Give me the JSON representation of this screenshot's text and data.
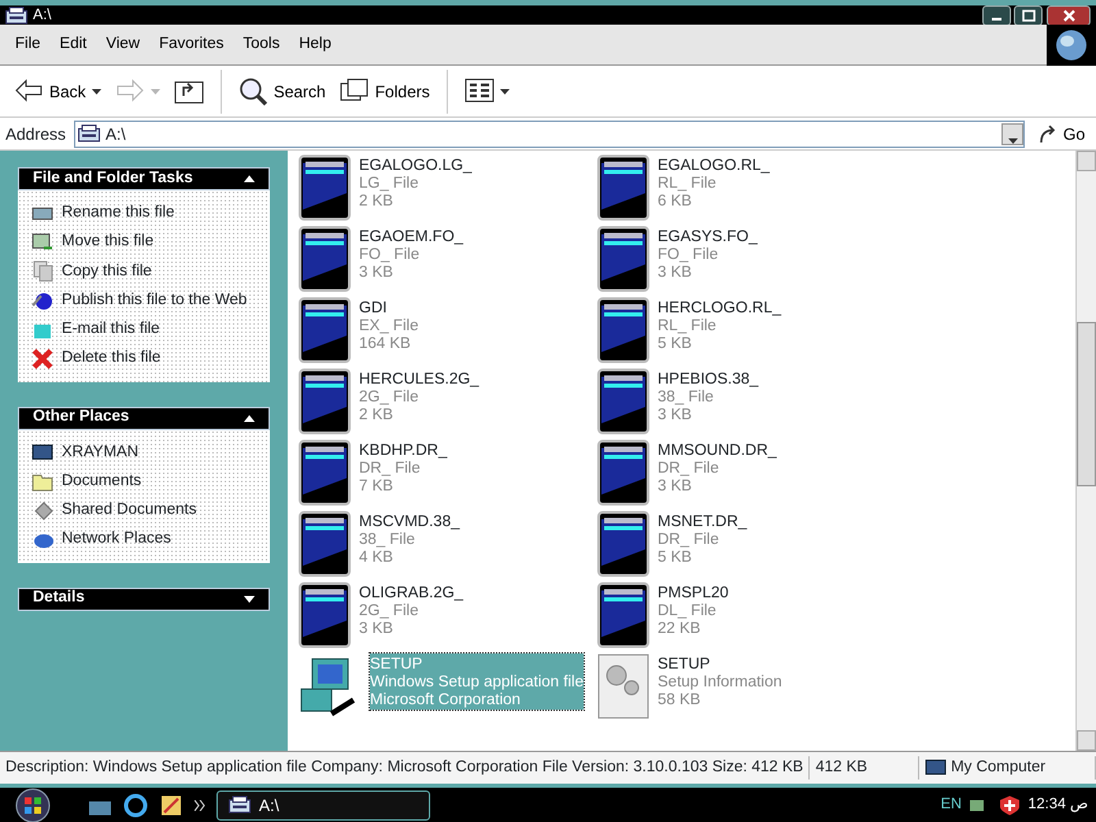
{
  "window": {
    "title": "A:\\"
  },
  "menu": [
    "File",
    "Edit",
    "View",
    "Favorites",
    "Tools",
    "Help"
  ],
  "toolbar": [
    {
      "kind": "back",
      "label": "Back",
      "disabled": false
    },
    {
      "kind": "forward",
      "disabled": true
    },
    {
      "kind": "up",
      "disabled": false
    },
    {
      "kind": "search",
      "label": "Search",
      "disabled": false
    },
    {
      "kind": "folders",
      "label": "Folders",
      "disabled": false
    },
    {
      "kind": "views",
      "disabled": false
    }
  ],
  "address": {
    "label": "Address",
    "value": "A:\\",
    "go": "Go"
  },
  "panels": [
    {
      "title": "File and Folder Tasks",
      "expanded": true,
      "items": [
        {
          "kind": "rename",
          "label": "Rename this file"
        },
        {
          "kind": "move",
          "label": "Move this file"
        },
        {
          "kind": "copy",
          "label": "Copy this file"
        },
        {
          "kind": "publish",
          "label": "Publish this file to the Web"
        },
        {
          "kind": "email",
          "label": "E-mail this file"
        },
        {
          "kind": "delete",
          "label": "Delete this file"
        }
      ]
    },
    {
      "title": "Other Places",
      "expanded": true,
      "items": [
        {
          "kind": "computer",
          "label": "XRAYMAN"
        },
        {
          "kind": "documents",
          "label": "Documents"
        },
        {
          "kind": "shared",
          "label": "Shared Documents"
        },
        {
          "kind": "network",
          "label": "Network Places"
        }
      ]
    },
    {
      "title": "Details",
      "expanded": false
    }
  ],
  "files": [
    {
      "kind": "disk",
      "name": "EGALOGO.LG_",
      "type": "LG_ File",
      "size": "2 KB",
      "selected": false
    },
    {
      "kind": "disk",
      "name": "EGALOGO.RL_",
      "type": "RL_ File",
      "size": "6 KB",
      "selected": false
    },
    {
      "kind": "disk",
      "name": "EGAOEM.FO_",
      "type": "FO_ File",
      "size": "3 KB",
      "selected": false
    },
    {
      "kind": "disk",
      "name": "EGASYS.FO_",
      "type": "FO_ File",
      "size": "3 KB",
      "selected": false
    },
    {
      "kind": "disk",
      "name": "GDI",
      "type": "EX_ File",
      "size": "164 KB",
      "selected": false
    },
    {
      "kind": "disk",
      "name": "HERCLOGO.RL_",
      "type": "RL_ File",
      "size": "5 KB",
      "selected": false
    },
    {
      "kind": "disk",
      "name": "HERCULES.2G_",
      "type": "2G_ File",
      "size": "2 KB",
      "selected": false
    },
    {
      "kind": "disk",
      "name": "HPEBIOS.38_",
      "type": "38_ File",
      "size": "3 KB",
      "selected": false
    },
    {
      "kind": "disk",
      "name": "KBDHP.DR_",
      "type": "DR_ File",
      "size": "7 KB",
      "selected": false
    },
    {
      "kind": "disk",
      "name": "MMSOUND.DR_",
      "type": "DR_ File",
      "size": "3 KB",
      "selected": false
    },
    {
      "kind": "disk",
      "name": "MSCVMD.38_",
      "type": "38_ File",
      "size": "4 KB",
      "selected": false
    },
    {
      "kind": "disk",
      "name": "MSNET.DR_",
      "type": "DR_ File",
      "size": "5 KB",
      "selected": false
    },
    {
      "kind": "disk",
      "name": "OLIGRAB.2G_",
      "type": "2G_ File",
      "size": "3 KB",
      "selected": false
    },
    {
      "kind": "disk",
      "name": "PMSPL20",
      "type": "DL_ File",
      "size": "22 KB",
      "selected": false
    },
    {
      "kind": "setup",
      "name": "SETUP",
      "type": "Windows Setup application file",
      "size": "Microsoft Corporation",
      "selected": true
    },
    {
      "kind": "ini",
      "name": "SETUP",
      "type": "Setup Information",
      "size": "58 KB",
      "selected": false
    }
  ],
  "status_bar": {
    "description": "Description: Windows Setup application file Company: Microsoft Corporation File Version: 3.10.0.103 Size: 412 KB",
    "size": "412 KB",
    "zone": "My Computer"
  },
  "taskbar": {
    "task": "A:\\",
    "language": "EN",
    "clock": "12:34 ص"
  }
}
